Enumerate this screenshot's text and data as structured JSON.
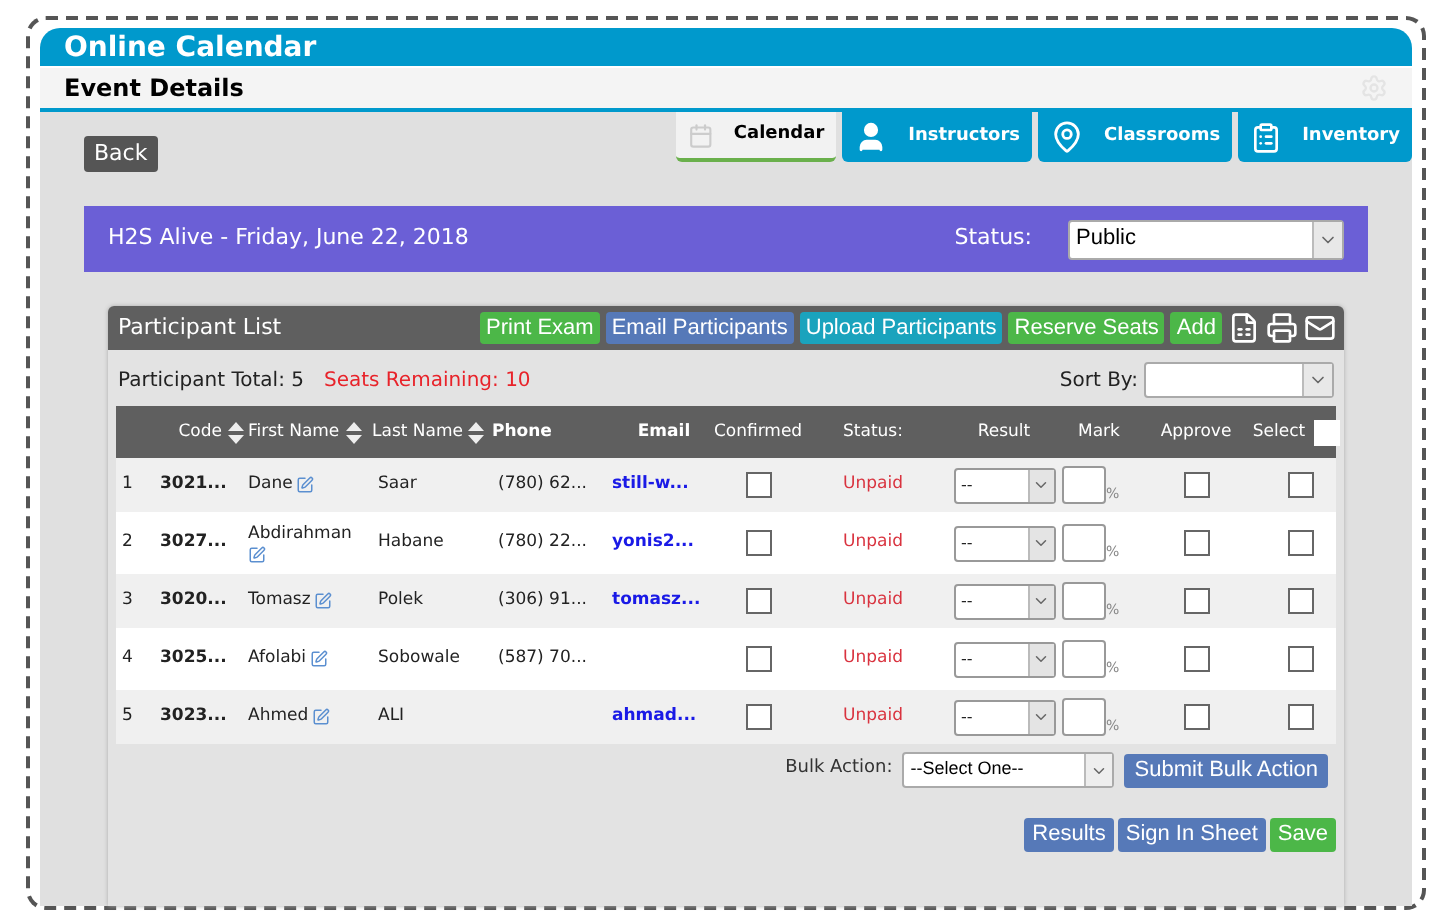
{
  "app_title": "Online Calendar",
  "page_title": "Event Details",
  "back_button": "Back",
  "tabs": [
    {
      "label": "Calendar",
      "selected": true,
      "kind": "calendar"
    },
    {
      "label": "Instructors",
      "selected": false,
      "kind": "person"
    },
    {
      "label": "Classrooms",
      "selected": false,
      "kind": "pin"
    },
    {
      "label": "Inventory",
      "selected": false,
      "kind": "clipboard"
    }
  ],
  "event": {
    "title": "H2S Alive - Friday, June 22, 2018",
    "status_label": "Status:",
    "status_value": "Public"
  },
  "panel": {
    "title": "Participant List",
    "actions": [
      {
        "label": "Print Exam",
        "color": "#4cb748"
      },
      {
        "label": "Email Participants",
        "color": "#5679b8"
      },
      {
        "label": "Upload Participants",
        "color": "#1aa3bd"
      },
      {
        "label": "Reserve Seats",
        "color": "#4cb748"
      },
      {
        "label": "Add",
        "color": "#4cb748"
      }
    ],
    "total": "Participant Total: 5",
    "seats_remaining": "Seats Remaining: 10",
    "sort_label": "Sort By:"
  },
  "table": {
    "columns": [
      {
        "label": "Code",
        "sortable": true
      },
      {
        "label": "First Name",
        "sortable": true
      },
      {
        "label": "Last Name",
        "sortable": true
      },
      {
        "label": "Phone",
        "sortable": false
      },
      {
        "label": "Email",
        "sortable": false
      },
      {
        "label": "Confirmed",
        "sortable": false
      },
      {
        "label": "Status:",
        "sortable": false
      },
      {
        "label": "Result",
        "sortable": false
      },
      {
        "label": "Mark",
        "sortable": false
      },
      {
        "label": "Approve",
        "sortable": false
      },
      {
        "label": "Select",
        "sortable": false
      }
    ],
    "select_all_checked": false,
    "rows": [
      {
        "index": "1",
        "code": "3021...",
        "first_name": "Dane",
        "last_name": "Saar",
        "phone": "(780) 62...",
        "email": "still-w...",
        "confirmed": false,
        "status": "Unpaid",
        "result": "--",
        "mark_unit": "%",
        "approved": false,
        "selected": false
      },
      {
        "index": "2",
        "code": "3027...",
        "first_name": "Abdirahman",
        "last_name": "Habane",
        "phone": "(780) 22...",
        "email": "yonis2...",
        "confirmed": false,
        "status": "Unpaid",
        "result": "--",
        "mark_unit": "%",
        "approved": false,
        "selected": false
      },
      {
        "index": "3",
        "code": "3020...",
        "first_name": "Tomasz",
        "last_name": "Polek",
        "phone": "(306) 91...",
        "email": "tomasz...",
        "confirmed": false,
        "status": "Unpaid",
        "result": "--",
        "mark_unit": "%",
        "approved": false,
        "selected": false
      },
      {
        "index": "4",
        "code": "3025...",
        "first_name": "Afolabi",
        "last_name": "Sobowale",
        "phone": "(587) 70...",
        "confirmed": false,
        "status": "Unpaid",
        "result": "--",
        "mark_unit": "%",
        "approved": false,
        "selected": false
      },
      {
        "index": "5",
        "code": "3023...",
        "first_name": "Ahmed",
        "last_name": "ALI",
        "email": "ahmad...",
        "confirmed": false,
        "status": "Unpaid",
        "result": "--",
        "mark_unit": "%",
        "approved": false,
        "selected": false
      }
    ]
  },
  "bulk": {
    "label": "Bulk Action:",
    "value": "--Select One--",
    "submit": "Submit Bulk Action"
  },
  "footer_buttons": [
    {
      "label": "Results",
      "color": "#5679b8"
    },
    {
      "label": "Sign In Sheet",
      "color": "#5679b8"
    },
    {
      "label": "Save",
      "color": "#4cb748"
    }
  ]
}
